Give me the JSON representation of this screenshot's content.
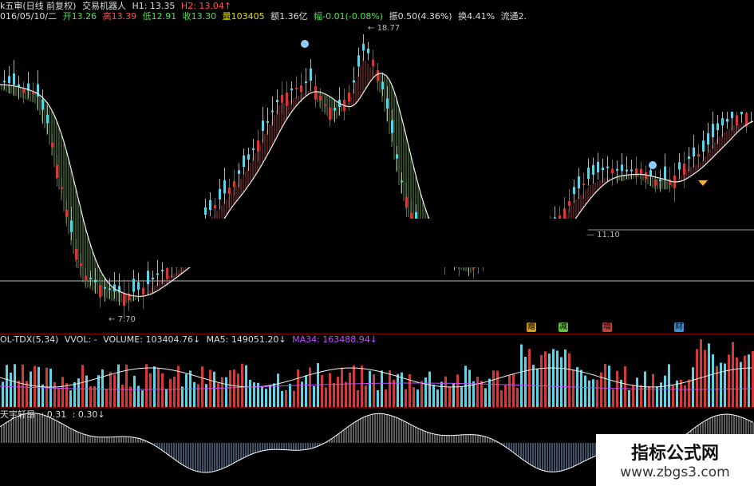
{
  "header": {
    "prefix": "k五审(日线 前复权)",
    "indicator": "交易机器人",
    "h1": "H1: 13.35",
    "h2": "H2: 13.04↑",
    "date": "016/05/10/二",
    "open": "开13.26",
    "high": "高13.39",
    "low": "低12.91",
    "close": "收13.30",
    "volume": "量103405",
    "amount": "额1.36亿",
    "change": "幅-0.01(-0.08%)",
    "amplitude": "振0.50(4.36%)",
    "turnover": "换4.41%",
    "float": "流通2."
  },
  "price_labels": {
    "high": "18.77",
    "low": "7.70",
    "level": "11.10"
  },
  "tags": [
    "赠",
    "减",
    "增",
    "财"
  ],
  "volume_header": {
    "name": "OL-TDX(5,34)",
    "vvol": "VVOL: -",
    "volume": "VOLUME: 103404.76↓",
    "ma5": "MA5: 149051.20↓",
    "ma34": "MA34: 163488.94↓"
  },
  "indicator_header": {
    "name": "天宇轩昂",
    "v1": ": 0.31",
    "v2": ": 0.30↓"
  },
  "watermark": {
    "line1": "指标公式网",
    "line2": "www.zbgs3.com"
  },
  "colors": {
    "up": "#d23a3a",
    "down": "#5fd3e6",
    "ribbon_up": "#c84a4a",
    "ribbon_down": "#7fbf5f",
    "ma_line": "#f0f0f0",
    "ma34": "#c050ff",
    "separator": "#7a0000"
  }
}
